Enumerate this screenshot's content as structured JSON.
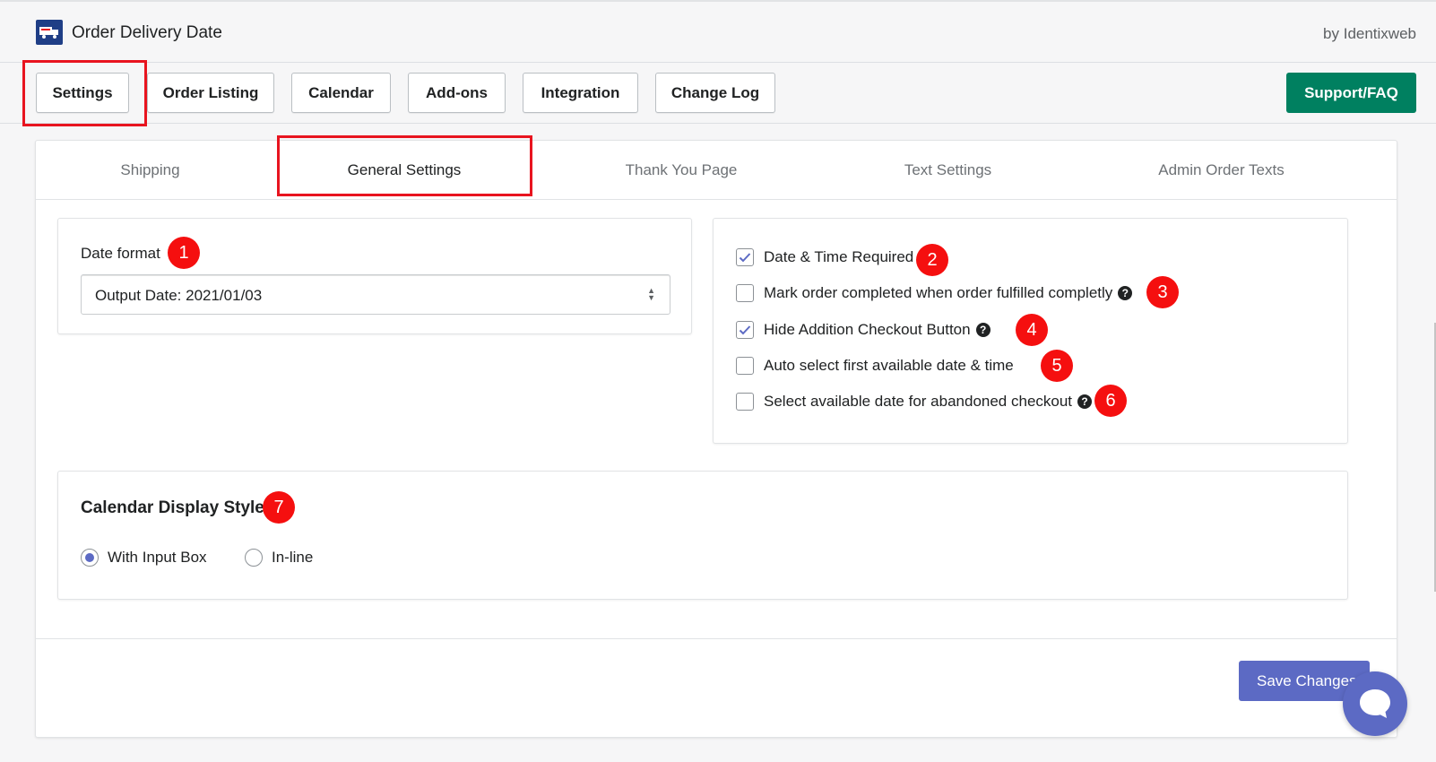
{
  "app": {
    "title": "Order Delivery Date",
    "byline": "by Identixweb"
  },
  "nav": {
    "items": [
      {
        "label": "Settings"
      },
      {
        "label": "Order Listing"
      },
      {
        "label": "Calendar"
      },
      {
        "label": "Add-ons"
      },
      {
        "label": "Integration"
      },
      {
        "label": "Change Log"
      }
    ],
    "support_label": "Support/FAQ"
  },
  "tabs": [
    {
      "label": "Shipping"
    },
    {
      "label": "General Settings"
    },
    {
      "label": "Thank You Page"
    },
    {
      "label": "Text Settings"
    },
    {
      "label": "Admin Order Texts"
    }
  ],
  "date_format": {
    "label": "Date format",
    "value": "Output Date: 2021/01/03",
    "badge": "1"
  },
  "options": [
    {
      "label": "Date & Time Required",
      "checked": true,
      "help": false,
      "badge": "2"
    },
    {
      "label": "Mark order completed when order fulfilled completly",
      "checked": false,
      "help": true,
      "badge": "3"
    },
    {
      "label": "Hide Addition Checkout Button",
      "checked": true,
      "help": true,
      "badge": "4"
    },
    {
      "label": "Auto select first available date & time",
      "checked": false,
      "help": false,
      "badge": "5"
    },
    {
      "label": "Select available date for abandoned checkout",
      "checked": false,
      "help": true,
      "badge": "6"
    }
  ],
  "calendar_style": {
    "title": "Calendar Display Style",
    "badge": "7",
    "options": [
      {
        "label": "With Input Box",
        "selected": true
      },
      {
        "label": "In-line",
        "selected": false
      }
    ]
  },
  "save_label": "Save Changes",
  "colors": {
    "annotation": "#e8141f",
    "badge": "#f50f0f",
    "primary": "#5c6ac4",
    "support": "#008060"
  },
  "icons": {
    "help": "question-circle-icon",
    "chat": "chat-bubble-icon",
    "logo": "delivery-truck-icon"
  }
}
